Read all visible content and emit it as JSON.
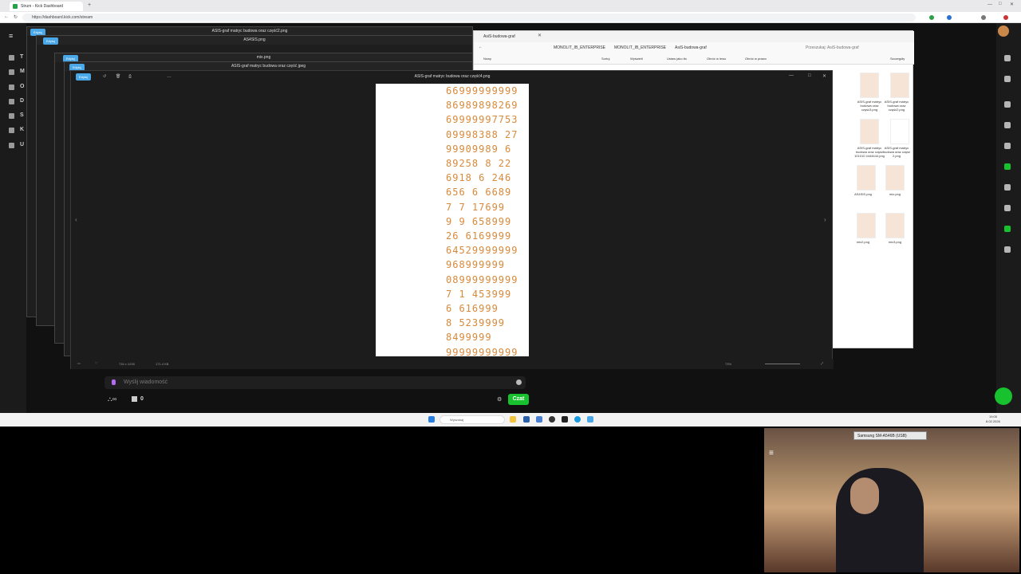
{
  "browser": {
    "tab_title": "Strum - Kick Dashboard",
    "url": "https://dashboard.kick.com/stream"
  },
  "stream_nav": {
    "letters": [
      "T",
      "M",
      "O",
      "D",
      "S",
      "K",
      "U"
    ]
  },
  "windows": {
    "back1_title": "ASIS-graf matryc budowa oraz część2.png",
    "back2_title": "AS4SIS.png",
    "back3_title": "mix.png",
    "back4_title": "ASIS-graf matryc budowa oraz część jpeg",
    "edit_label": "Edytuj"
  },
  "viewer": {
    "title": "ASIS-graf matryc budowa oraz część4.png",
    "dimensions": "734 x 1235",
    "filesize": "171.4 KB",
    "zoom": "73%",
    "doc_lines": [
      "66999999999",
      "86989898269",
      "69999997753",
      "09998388 27",
      "99909989 6",
      "89258 8 22",
      "6918 6 246",
      "656 6 6689",
      "7 7 17699",
      "9 9 658999",
      "26 6169999",
      "64529999999",
      "968999999",
      "08999999999",
      "7 1 453999",
      "6 616999",
      "8 5239999",
      "8499999",
      "99999999999"
    ]
  },
  "explorer": {
    "title": "AsiS-budowa-graf",
    "path": [
      "MONOLIT_IB_ENTERPRISE",
      "MONOLIT_IB_ENTERPRISE",
      "AsiS-budowa-graf"
    ],
    "search_placeholder": "Przeszukaj: AsiS-budowa-graf",
    "toolbar": [
      "Nowy",
      "Sortuj",
      "Wyświetl",
      "Ustaw jako tło",
      "Obróć w lewo",
      "Obróć w prawo",
      "Szczegóły"
    ],
    "files": [
      "ASIS-graf matryc budowa oraz część3.png",
      "ASIS-graf matryc budowa oraz część2.png",
      "ASIS-graf matryc budowa oraz część 101010 4444444.png",
      "ASIS-graf matryc budowa oraz część 2.png",
      "AS4SIS.png",
      "mix.png",
      "mix2.png",
      "mix3.png"
    ]
  },
  "chat": {
    "placeholder": "Wyślij wiadomość",
    "counter": "0",
    "send_label": "Czat"
  },
  "taskbar": {
    "search_label": "Wyszukaj",
    "time": "19:05",
    "date": "8.02.2026"
  },
  "webcam": {
    "device_label": "Samsung SM-A546B (USB)"
  }
}
